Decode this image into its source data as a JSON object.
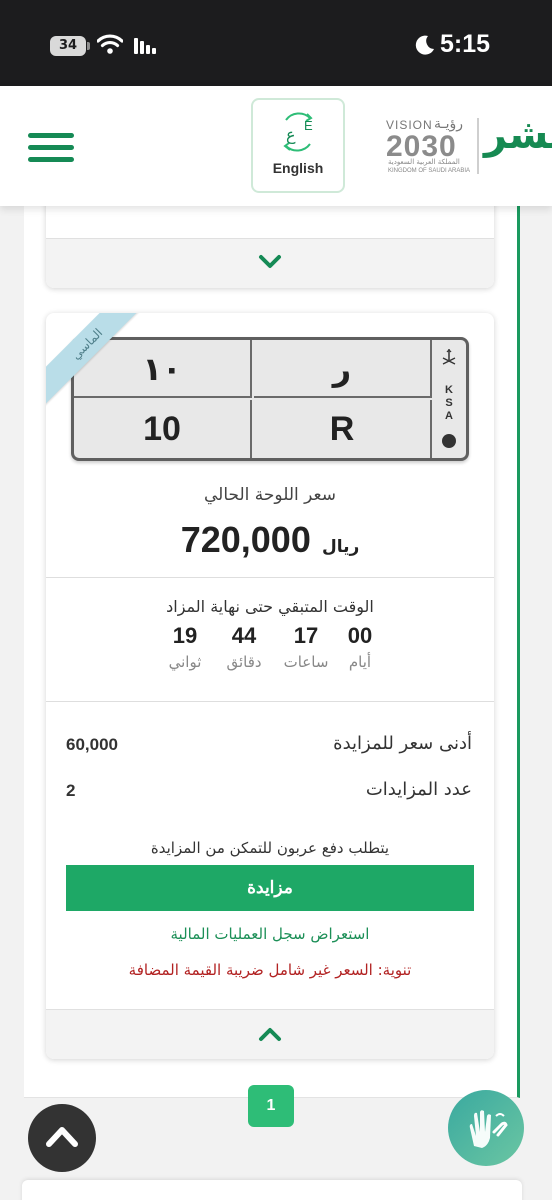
{
  "status_bar": {
    "battery_level": "34",
    "time": "5:15"
  },
  "header": {
    "language_button": "English",
    "language_glyph_ar": "ع",
    "language_glyph_en": "E",
    "vision_text": "VISION",
    "vision_text_ar": "رؤيـة",
    "vision_year": "2030",
    "vision_country_ar": "المملكة العربية السعودية",
    "vision_country_en": "KINGDOM OF SAUDI ARABIA",
    "absher_logo": "أبشر"
  },
  "plate_card": {
    "ribbon_label": "الماسي",
    "plate": {
      "number_ar": "١٠",
      "letter_ar": "ر",
      "number_en": "10",
      "letter_en": "R",
      "side_letters": [
        "K",
        "S",
        "A"
      ]
    },
    "price_label": "سعر اللوحة الحالي",
    "price_value": "720,000",
    "price_currency": "ريال",
    "timer_label": "الوقت المتبقي حتى نهاية المزاد",
    "timer": {
      "days": {
        "value": "00",
        "label": "أيام"
      },
      "hours": {
        "value": "17",
        "label": "ساعات"
      },
      "minutes": {
        "value": "44",
        "label": "دقائق"
      },
      "seconds": {
        "value": "19",
        "label": "ثواني"
      }
    },
    "min_bid_label": "أدنى سعر للمزايدة",
    "min_bid_value": "60,000",
    "bid_count_label": "عدد المزايدات",
    "bid_count_value": "2",
    "deposit_note": "يتطلب دفع عربون للتمكن من المزايدة",
    "bid_button": "مزايدة",
    "financial_history_link": "استعراض سجل العمليات المالية",
    "vat_note": "تنوية: السعر غير شامل ضريبة القيمة المضافة"
  },
  "pagination": {
    "current_page": "1"
  },
  "colors": {
    "brand_green": "#158a55",
    "button_green": "#1ea866",
    "warning_red": "#b22222",
    "ribbon_blue": "#b9dde8"
  }
}
